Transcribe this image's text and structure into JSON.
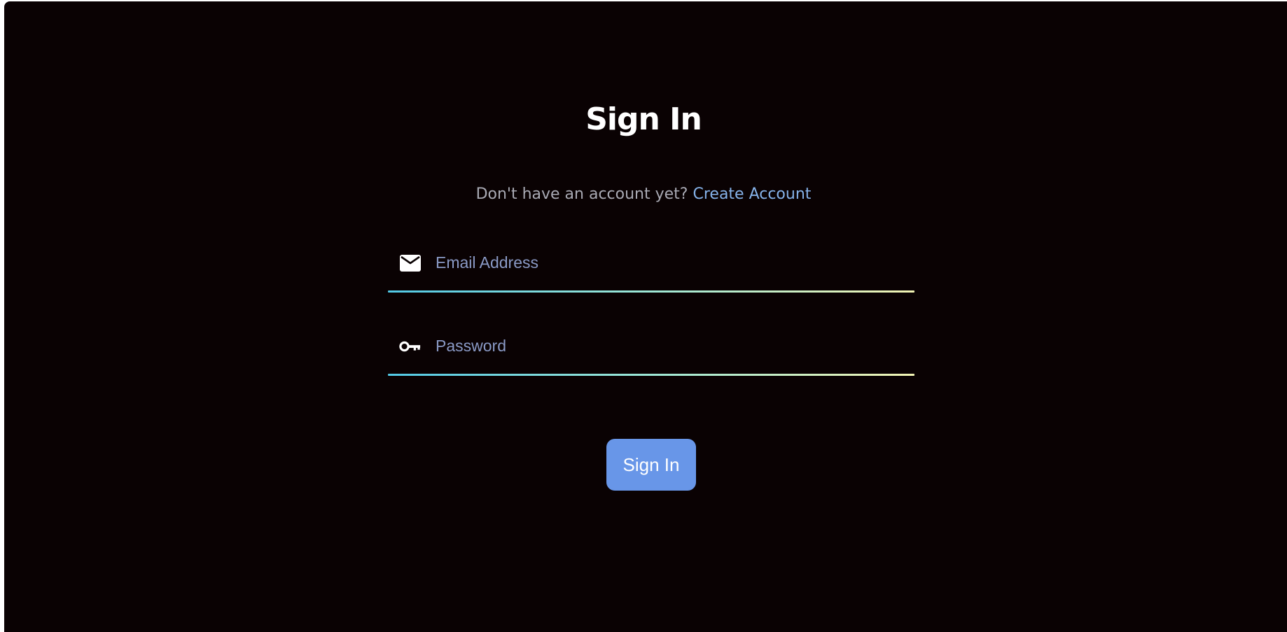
{
  "page": {
    "title": "Sign In"
  },
  "signup": {
    "prompt": "Don't have an account yet?",
    "link_label": "Create Account"
  },
  "form": {
    "email": {
      "placeholder": "Email Address",
      "value": "",
      "icon": "envelope-icon"
    },
    "password": {
      "placeholder": "Password",
      "value": "",
      "icon": "key-icon"
    },
    "submit_label": "Sign In"
  },
  "colors": {
    "background": "#0a0203",
    "title": "#ffffff",
    "prompt_text": "#a9aab4",
    "link": "#86b3ea",
    "placeholder": "#8a9ac6",
    "underline_start": "#52c9e6",
    "underline_end": "#f3f5b4",
    "button": "#6896e8"
  }
}
